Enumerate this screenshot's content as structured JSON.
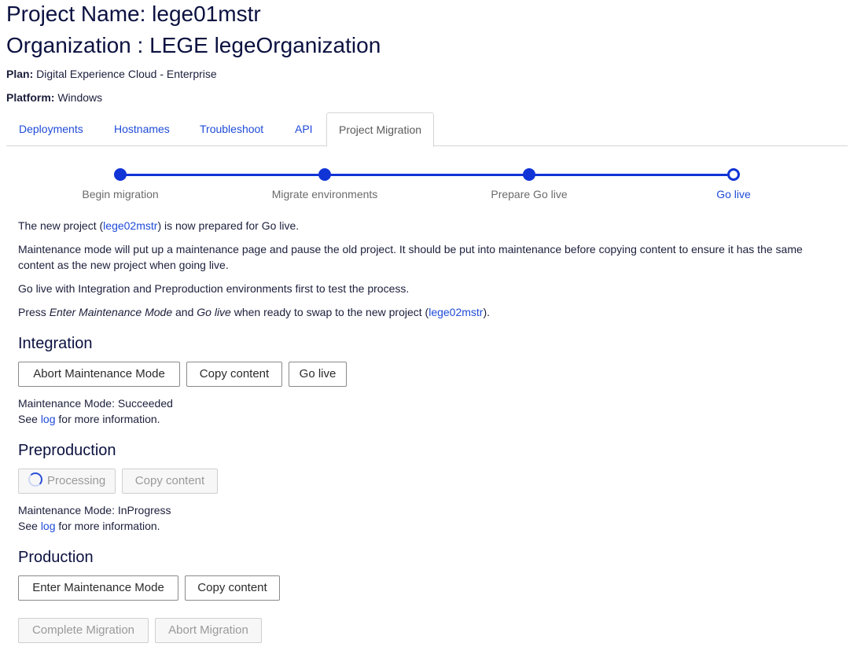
{
  "header": {
    "project_name": "Project Name: lege01mstr",
    "organization": "Organization : LEGE legeOrganization",
    "plan_label": "Plan:",
    "plan_value": "Digital Experience Cloud - Enterprise",
    "platform_label": "Platform:",
    "platform_value": "Windows"
  },
  "tabs": [
    {
      "label": "Deployments"
    },
    {
      "label": "Hostnames"
    },
    {
      "label": "Troubleshoot"
    },
    {
      "label": "API"
    },
    {
      "label": "Project Migration",
      "active": true
    }
  ],
  "stepper": {
    "steps": [
      {
        "label": "Begin migration",
        "state": "done"
      },
      {
        "label": "Migrate environments",
        "state": "done"
      },
      {
        "label": "Prepare Go live",
        "state": "done"
      },
      {
        "label": "Go live",
        "state": "current"
      }
    ],
    "accent": "#1134d6"
  },
  "intro": {
    "p1_before": "The new project (",
    "p1_link": "lege02mstr",
    "p1_after": ") is now prepared for Go live.",
    "p2": "Maintenance mode will put up a maintenance page and pause the old project. It should be put into maintenance before copying content to ensure it has the same content as the new project when going live.",
    "p3": "Go live with Integration and Preproduction environments first to test the process.",
    "p4_a": "Press ",
    "p4_em1": "Enter Maintenance Mode",
    "p4_b": " and ",
    "p4_em2": "Go live",
    "p4_c": " when ready to swap to the new project (",
    "p4_link": "lege02mstr",
    "p4_d": ")."
  },
  "integration": {
    "heading": "Integration",
    "buttons": [
      "Abort Maintenance Mode",
      "Copy content",
      "Go live"
    ],
    "status": "Maintenance Mode: Succeeded",
    "see": "See ",
    "log": "log",
    "more": " for more information."
  },
  "preproduction": {
    "heading": "Preproduction",
    "buttons": [
      "Processing",
      "Copy content"
    ],
    "status": "Maintenance Mode: InProgress",
    "see": "See ",
    "log": "log",
    "more": " for more information."
  },
  "production": {
    "heading": "Production",
    "buttons": [
      "Enter Maintenance Mode",
      "Copy content"
    ]
  },
  "footer": {
    "buttons": [
      "Complete Migration",
      "Abort Migration"
    ]
  }
}
